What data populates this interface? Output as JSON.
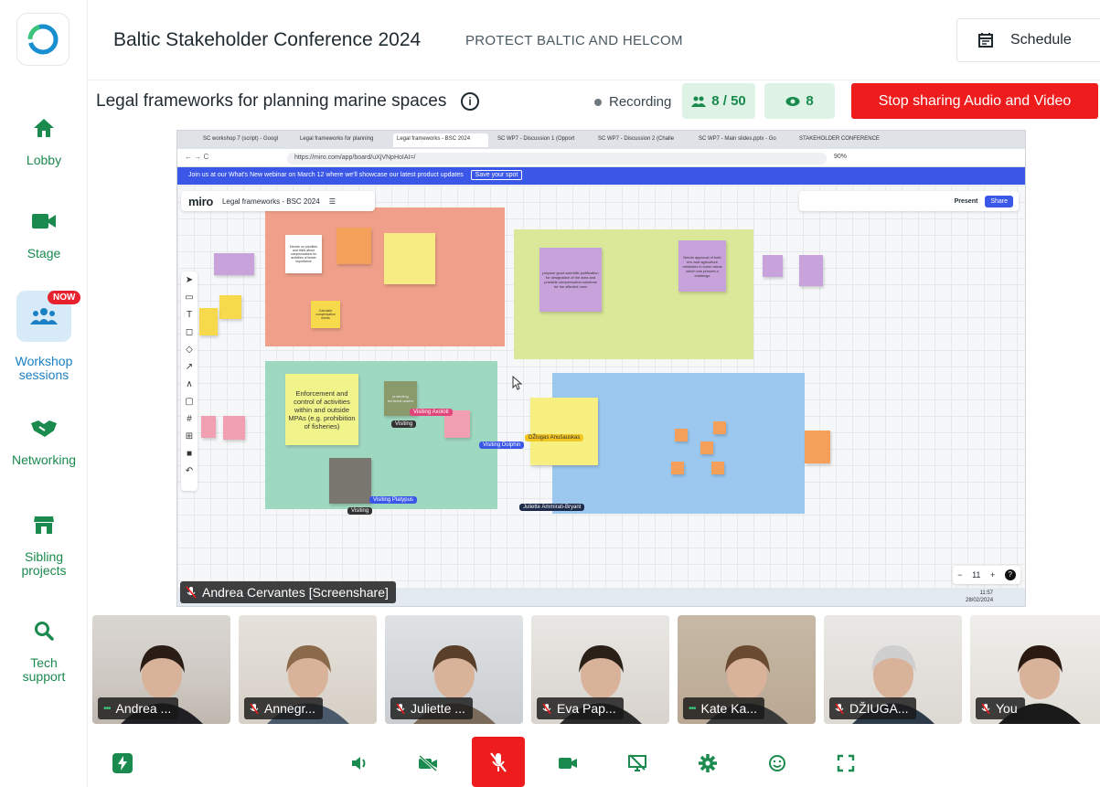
{
  "conference": {
    "title": "Baltic Stakeholder Conference 2024",
    "subtitle": "PROTECT BALTIC AND HELCOM",
    "schedule_label": "Schedule"
  },
  "sidebar": {
    "items": [
      {
        "label": "Lobby",
        "icon": "home-icon"
      },
      {
        "label": "Stage",
        "icon": "video-camera-icon"
      },
      {
        "label": "Workshop sessions",
        "icon": "people-group-icon",
        "badge": "NOW",
        "active": true
      },
      {
        "label": "Networking",
        "icon": "handshake-icon"
      },
      {
        "label": "Sibling projects",
        "icon": "store-icon"
      },
      {
        "label": "Tech support",
        "icon": "search-icon"
      }
    ]
  },
  "session": {
    "title": "Legal frameworks for planning marine spaces",
    "recording_label": "Recording",
    "participants": "8 / 50",
    "viewers": "8",
    "stop_label": "Stop sharing Audio and Video"
  },
  "screenshare": {
    "presenter_label": "Andrea Cervantes [Screenshare]",
    "browser_tabs": [
      "SC workshop 7 (script) - Googl",
      "Legal frameworks for planning",
      "Legal frameworks - BSC 2024",
      "SC WP7 - Discussion 1 (Opport",
      "SC WP7 - Discussion 2 (Challe",
      "SC WP7 - Main slides.pptx - Go",
      "STAKEHOLDER CONFERENCE"
    ],
    "url": "https://miro.com/app/board/uXjVNpHoIAI=/",
    "zoom": "90%",
    "banner_text": "Join us at our What's New webinar on March 12 where we'll showcase our latest product updates",
    "banner_cta": "Save your spot",
    "miro_brand": "miro",
    "board_name": "Legal frameworks - BSC 2024",
    "present_label": "Present",
    "share_label": "Share",
    "zoom_pct": "11",
    "clock": "11:57",
    "date": "28/02/2024",
    "stickies": {
      "s1": "Decide on priorities and think about compensations for activities of lesser importance",
      "s2": "Calculate compensation needs",
      "s3": "prepare good scientific justification for designation of the area and possible compensation solutions for the affected ones",
      "s4": "Needs approval of both env and agriculture ministries in some areas which can present a challenge",
      "s5": "Enforcement and control of activities within and outside MPAs (e.g. prohibition of fisheries)",
      "s6": "protecting territorial waters"
    },
    "cursors": [
      {
        "name": "Visiting Axolotl",
        "color": "#e0457b"
      },
      {
        "name": "Visiting Dolphin",
        "color": "#3a57e8"
      },
      {
        "name": "Visiting Platypus",
        "color": "#3a57e8"
      },
      {
        "name": "DŽiugas Anušauskas",
        "color": "#f3c623"
      },
      {
        "name": "Juliette Ammirati-Bryant",
        "color": "#1e2a4a"
      },
      {
        "name": "Visiting",
        "color": "#333333"
      }
    ]
  },
  "participants": [
    {
      "name": "Andrea ...",
      "muted": false
    },
    {
      "name": "Annegr...",
      "muted": true
    },
    {
      "name": "Juliette ...",
      "muted": true
    },
    {
      "name": "Eva Pap...",
      "muted": true
    },
    {
      "name": "Kate Ka...",
      "muted": false
    },
    {
      "name": "DŽIUGA...",
      "muted": true
    },
    {
      "name": "You",
      "muted": true
    }
  ],
  "colors": {
    "accent_green": "#1a8a4e",
    "active_blue": "#1a7fc4",
    "stop_red": "#ee1c1c",
    "pill_bg": "#def3e6"
  }
}
